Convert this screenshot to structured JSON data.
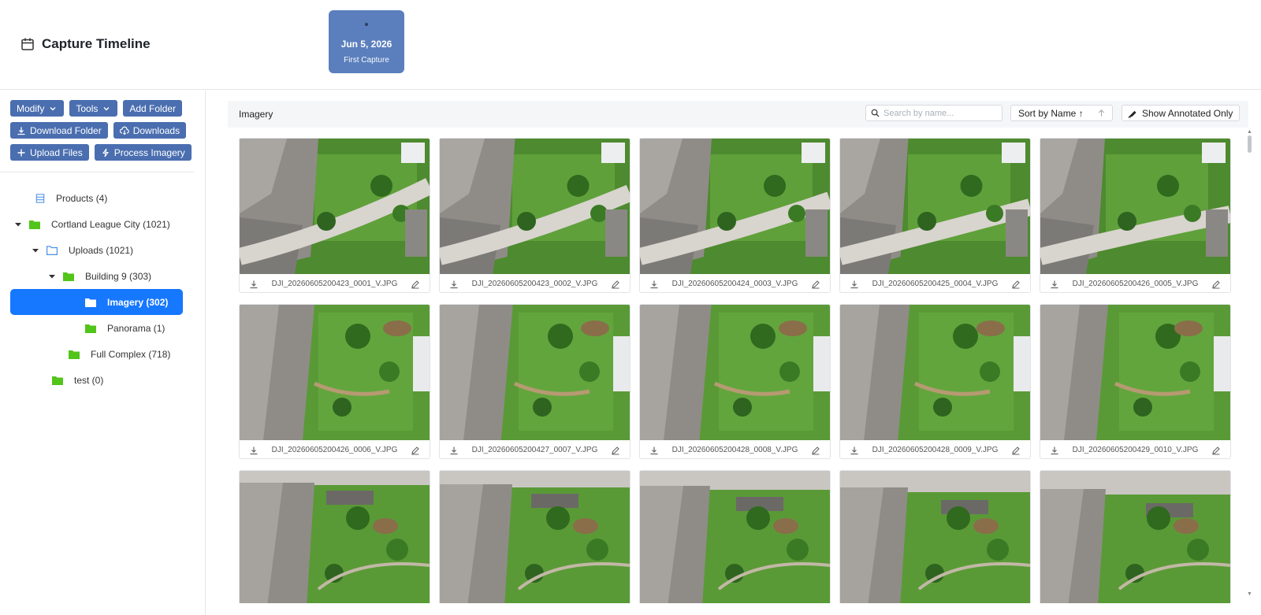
{
  "header": {
    "title": "Capture Timeline",
    "capture": {
      "date": "Jun 5, 2026",
      "label": "First Capture"
    }
  },
  "sidebar": {
    "buttons": {
      "modify": "Modify",
      "tools": "Tools",
      "add_folder": "Add Folder",
      "download_folder": "Download Folder",
      "downloads": "Downloads",
      "upload_files": "Upload Files",
      "process_imagery": "Process Imagery"
    },
    "tree": [
      {
        "label": "Products (4)",
        "icon": "list-icon"
      },
      {
        "label": "Cortland League City (1021)",
        "icon": "folder-icon",
        "expanded": true
      },
      {
        "label": "Uploads (1021)",
        "icon": "folder-outline-icon",
        "expanded": true
      },
      {
        "label": "Building 9 (303)",
        "icon": "folder-icon",
        "expanded": true
      },
      {
        "label": "Imagery (302)",
        "icon": "folder-icon",
        "selected": true
      },
      {
        "label": "Panorama (1)",
        "icon": "folder-icon"
      },
      {
        "label": "Full Complex (718)",
        "icon": "folder-icon"
      },
      {
        "label": "test (0)",
        "icon": "folder-icon"
      }
    ]
  },
  "main": {
    "title": "Imagery",
    "search_placeholder": "Search by name...",
    "sort_label": "Sort by Name ↑",
    "annotated_label": "Show Annotated Only",
    "images": [
      "DJI_20260605200423_0001_V.JPG",
      "DJI_20260605200423_0002_V.JPG",
      "DJI_20260605200424_0003_V.JPG",
      "DJI_20260605200425_0004_V.JPG",
      "DJI_20260605200426_0005_V.JPG",
      "DJI_20260605200426_0006_V.JPG",
      "DJI_20260605200427_0007_V.JPG",
      "DJI_20260605200428_0008_V.JPG",
      "DJI_20260605200428_0009_V.JPG",
      "DJI_20260605200429_0010_V.JPG",
      "",
      "",
      "",
      "",
      ""
    ]
  },
  "colors": {
    "accent": "#1677ff",
    "toolbar_button": "#4a6eaf",
    "capture_card": "#5b7fbd",
    "folder_green": "#52c41a",
    "folder_blue": "#4a90e2"
  }
}
